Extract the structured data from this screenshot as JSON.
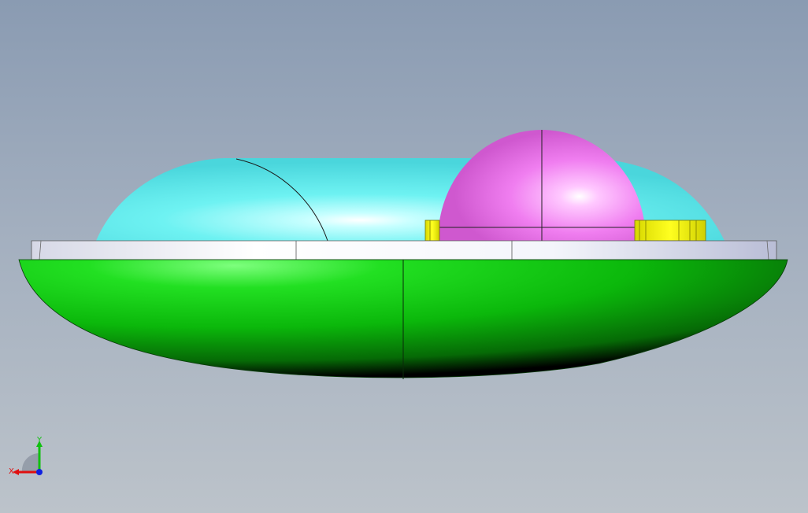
{
  "viewport": {
    "background_top": "#8a9bb2",
    "background_bottom": "#bcc3ca"
  },
  "model": {
    "parts": [
      {
        "name": "capsule-body",
        "color": "#6ef2f2"
      },
      {
        "name": "sphere-dome",
        "color": "#f07ef0"
      },
      {
        "name": "yellow-brackets",
        "color": "#f2f200"
      },
      {
        "name": "silver-rim",
        "color": "#e8eaf2"
      },
      {
        "name": "green-hull",
        "color": "#0bbf0b"
      }
    ]
  },
  "triad": {
    "x_label": "X",
    "y_label": "Y",
    "x_color": "#e01010",
    "y_color": "#10c010",
    "z_color": "#1020e0"
  }
}
